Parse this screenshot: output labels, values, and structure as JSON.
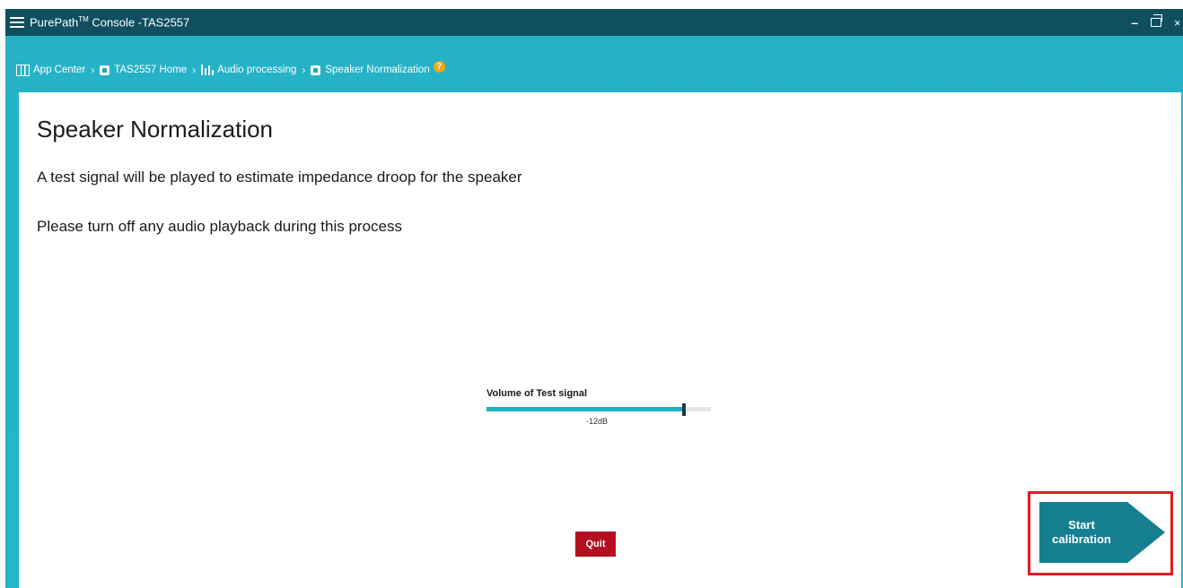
{
  "window": {
    "title": "PurePath",
    "title_tm": "TM",
    "title_suffix": " Console -TAS2557",
    "controls": {
      "minimize": "–",
      "close": "×"
    }
  },
  "breadcrumb": {
    "items": [
      {
        "label": "App Center",
        "icon": "app-grid-icon"
      },
      {
        "label": "TAS2557 Home",
        "icon": "chip-icon"
      },
      {
        "label": "Audio processing",
        "icon": "equalizer-icon"
      },
      {
        "label": "Speaker Normalization",
        "icon": "chip-icon"
      }
    ],
    "separator": "›",
    "help": "?"
  },
  "page": {
    "title": "Speaker Normalization",
    "description_1": "A test signal will be played to estimate impedance droop for the speaker",
    "description_2": "Please turn off any audio playback during this process"
  },
  "slider": {
    "label": "Volume of Test signal",
    "value_text": "-12dB",
    "level_fraction": 0.88
  },
  "buttons": {
    "quit": "Quit",
    "start_calibration": "Start\ncalibration"
  },
  "colors": {
    "titlebar": "#0f4f60",
    "accent": "#1bb0c5",
    "quit": "#b40f1e",
    "start": "#157f91",
    "highlight": "#e11b23",
    "help": "#f3a715"
  }
}
